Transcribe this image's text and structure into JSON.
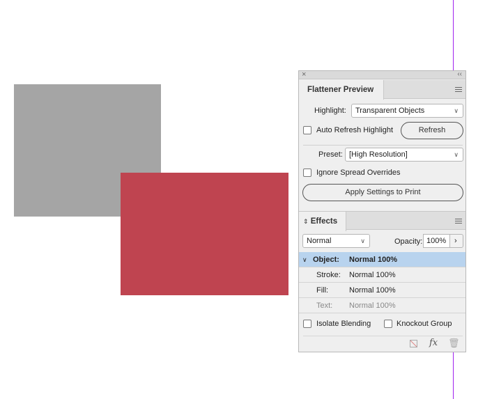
{
  "canvas": {
    "gray_rect_color": "#a5a5a5",
    "red_rect_color": "#bf4450",
    "guide_color": "#a020f0"
  },
  "titlebar": {
    "close": "×",
    "collapse": "‹‹"
  },
  "flattener": {
    "tab": "Flattener Preview",
    "highlight_label": "Highlight:",
    "highlight_value": "Transparent Objects",
    "auto_refresh_label": "Auto Refresh Highlight",
    "auto_refresh_checked": false,
    "refresh_button": "Refresh",
    "preset_label": "Preset:",
    "preset_value": "[High Resolution]",
    "ignore_spread_label": "Ignore Spread Overrides",
    "ignore_spread_checked": false,
    "apply_button": "Apply Settings to Print"
  },
  "effects": {
    "tab": "Effects",
    "blend_mode": "Normal",
    "opacity_label": "Opacity:",
    "opacity_value": "100%",
    "rows": [
      {
        "label": "Object:",
        "value": "Normal 100%"
      },
      {
        "label": "Stroke:",
        "value": "Normal 100%"
      },
      {
        "label": "Fill:",
        "value": "Normal 100%"
      },
      {
        "label": "Text:",
        "value": "Normal 100%"
      }
    ],
    "isolate_label": "Isolate Blending",
    "knockout_label": "Knockout Group",
    "fx_label": "fx"
  }
}
